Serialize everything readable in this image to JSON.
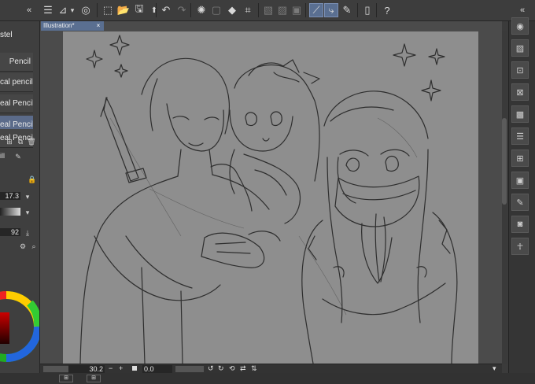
{
  "toolbar": {
    "icons": [
      "menu-icon",
      "brush-size-icon",
      "chevron-down-icon",
      "lasso-icon",
      "select-icon",
      "folder-icon",
      "save-icon",
      "export-icon",
      "undo-icon",
      "redo-icon",
      "spinner-icon",
      "fill-icon",
      "transform-icon",
      "clear-icon",
      "layer-icon",
      "stroke-icon",
      "pen-stabilize-icon",
      "pen-smooth-icon",
      "pen-width-icon",
      "tablet-icon",
      "help-icon"
    ]
  },
  "brushes": {
    "header": "stel",
    "items": [
      {
        "label": "Pencil",
        "selected": false
      },
      {
        "label": "cal pencil",
        "selected": false
      },
      {
        "label": "eal Pencil",
        "selected": false
      },
      {
        "label": "eal Pencil",
        "selected": true
      },
      {
        "label": "eal Pencil",
        "selected": false
      }
    ],
    "size_value": "17.3",
    "opacity_value": "92",
    "sub_label": "ill"
  },
  "document": {
    "tab_label": "Illustration*",
    "close_glyph": "×"
  },
  "bottom": {
    "zoom_value": "30.2",
    "rotation_value": "0.0"
  },
  "colors": {
    "accent": "#5a6f91",
    "canvas": "#8e8e8e",
    "panel": "#3f3f3f"
  }
}
